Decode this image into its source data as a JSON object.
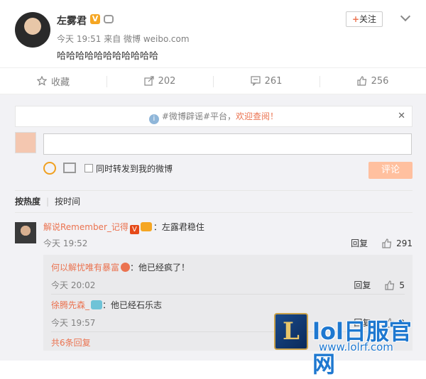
{
  "post": {
    "author": "左雾君",
    "meta": "今天 19:51 来自 微博 weibo.com",
    "content": "哈哈哈哈哈哈哈哈哈哈哈",
    "follow_label": "关注"
  },
  "actions": [
    {
      "label": "收藏",
      "icon": "star-icon"
    },
    {
      "label": "202",
      "icon": "share-icon"
    },
    {
      "label": "261",
      "icon": "comment-icon"
    },
    {
      "label": "256",
      "icon": "like-icon"
    }
  ],
  "notice": {
    "prefix": "#微博辟谣#平台，",
    "highlight": "欢迎查阅！"
  },
  "composer": {
    "repost_label": "同时转发到我的微博",
    "submit_label": "评论"
  },
  "sort": {
    "hot": "按热度",
    "time": "按时间"
  },
  "comment": {
    "user": "解说Remember_记得",
    "text": "：左露君稳住",
    "time": "今天 19:52",
    "reply": "回复",
    "likes": "291"
  },
  "replies": [
    {
      "user": "何以解忧唯有暴富",
      "text": "：他已经疯了！",
      "time": "今天 20:02",
      "reply": "回复",
      "likes": "5"
    },
    {
      "user": "徐腾先森_",
      "text": "：他已经石乐志",
      "time": "今天 19:57",
      "reply": "回复",
      "likes": "2"
    }
  ],
  "more_replies": "共6条回复",
  "watermark": {
    "title": "lol日服官网",
    "url": "www.lolrf.com"
  }
}
